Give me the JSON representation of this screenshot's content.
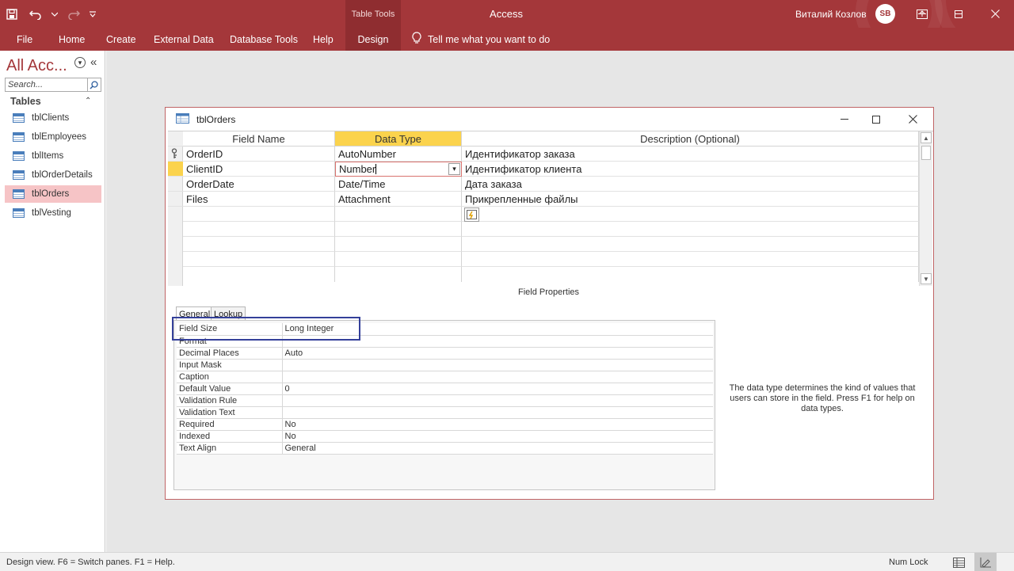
{
  "window": {
    "app_title": "Access",
    "context_tab_header": "Table Tools",
    "user_name": "Виталий Козлов",
    "user_avatar_initials": "SB"
  },
  "ribbon": {
    "tabs": [
      "File",
      "Home",
      "Create",
      "External Data",
      "Database Tools",
      "Help",
      "Design"
    ],
    "active_tab": "Design",
    "tell_me": "Tell me what you want to do"
  },
  "nav": {
    "title": "All Acc...",
    "search_placeholder": "Search...",
    "group": "Tables",
    "items": [
      "tblClients",
      "tblEmployees",
      "tblItems",
      "tblOrderDetails",
      "tblOrders",
      "tblVesting"
    ],
    "selected": "tblOrders"
  },
  "document": {
    "title": "tblOrders",
    "columns": {
      "field_name": "Field Name",
      "data_type": "Data Type",
      "description": "Description (Optional)"
    },
    "rows": [
      {
        "field": "OrderID",
        "type": "AutoNumber",
        "desc": "Идентификатор заказа",
        "primary_key": true
      },
      {
        "field": "ClientID",
        "type": "Number",
        "desc": "Идентификатор клиента"
      },
      {
        "field": "OrderDate",
        "type": "Date/Time",
        "desc": "Дата заказа"
      },
      {
        "field": "Files",
        "type": "Attachment",
        "desc": "Прикрепленные файлы"
      }
    ],
    "current_row": "ClientID"
  },
  "field_properties": {
    "title": "Field Properties",
    "tabs": [
      "General",
      "Lookup"
    ],
    "active_tab": "General",
    "props": [
      {
        "label": "Field Size",
        "value": "Long Integer"
      },
      {
        "label": "Format",
        "value": ""
      },
      {
        "label": "Decimal Places",
        "value": "Auto"
      },
      {
        "label": "Input Mask",
        "value": ""
      },
      {
        "label": "Caption",
        "value": ""
      },
      {
        "label": "Default Value",
        "value": "0"
      },
      {
        "label": "Validation Rule",
        "value": ""
      },
      {
        "label": "Validation Text",
        "value": ""
      },
      {
        "label": "Required",
        "value": "No"
      },
      {
        "label": "Indexed",
        "value": "No"
      },
      {
        "label": "Text Align",
        "value": "General"
      }
    ],
    "help_text": "The data type determines the kind of values that users can store in the field. Press F1 for help on data types."
  },
  "status": {
    "text": "Design view.  F6 = Switch panes.  F1 = Help.",
    "num_lock": "Num Lock"
  },
  "colors": {
    "accent": "#a4373a",
    "header_highlight": "#fbd34d",
    "nav_selected": "#f6c4c6",
    "annotation_box": "#34409a"
  }
}
